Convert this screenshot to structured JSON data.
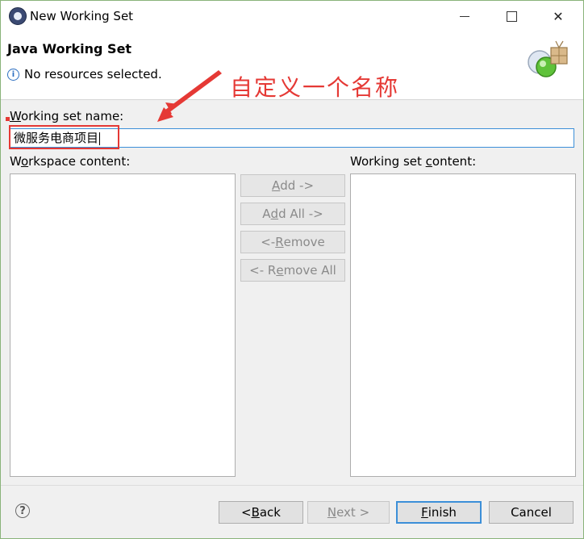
{
  "window": {
    "title": "New Working Set",
    "controls": {
      "minimize": "minimize",
      "maximize": "maximize",
      "close": "✕"
    }
  },
  "header": {
    "title": "Java Working Set",
    "message": "No resources selected."
  },
  "annotation": {
    "text": "自定义一个名称",
    "color": "#e53935"
  },
  "form": {
    "name_label": "Working set name:",
    "name_value": "微服务电商项目",
    "workspace_label": "Workspace content:",
    "content_label": "Working set content:"
  },
  "middle_buttons": {
    "add": "Add ->",
    "add_all": "Add All ->",
    "remove": "<- Remove",
    "remove_all": "<- Remove All"
  },
  "footer": {
    "back": "< Back",
    "next": "Next >",
    "finish": "Finish",
    "cancel": "Cancel"
  },
  "colors": {
    "accent": "#3c8fd8",
    "annotation_red": "#e53935"
  }
}
